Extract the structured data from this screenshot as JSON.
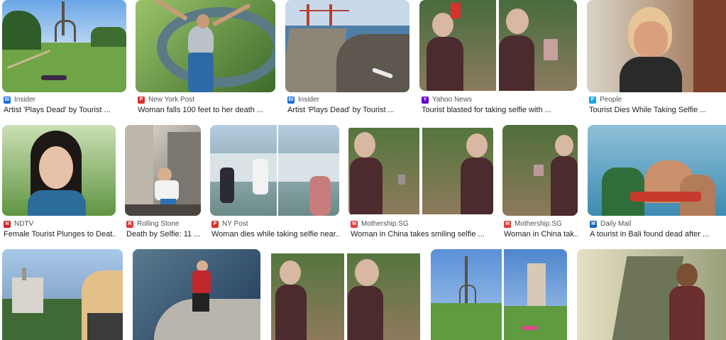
{
  "results": [
    {
      "source": "Insider",
      "caption": "Artist 'Plays Dead' by Tourist ...",
      "fav_color": "#1a6de0",
      "fav_glyph": "BI",
      "icon": "insider-favicon-icon"
    },
    {
      "source": "New York Post",
      "caption": "Woman falls 100 feet to her death ...",
      "fav_color": "#d93025",
      "fav_glyph": "P",
      "icon": "nypost-favicon-icon"
    },
    {
      "source": "Insider",
      "caption": "Artist 'Plays Dead' by Tourist ...",
      "fav_color": "#1a6de0",
      "fav_glyph": "BI",
      "icon": "insider-favicon-icon"
    },
    {
      "source": "Yahoo News",
      "caption": "Tourist blasted for taking selfie with ...",
      "fav_color": "#6001d2",
      "fav_glyph": "Y",
      "icon": "yahoo-favicon-icon"
    },
    {
      "source": "People",
      "caption": "Tourist Dies While Taking Selfie ...",
      "fav_color": "#1ba1e2",
      "fav_glyph": "P",
      "icon": "people-favicon-icon"
    },
    {
      "source": "NDTV",
      "caption": "Female Tourist Plunges to Deat...",
      "fav_color": "#c62828",
      "fav_glyph": "N",
      "icon": "ndtv-favicon-icon"
    },
    {
      "source": "Rolling Stone",
      "caption": "Death by Selfie: 11 ...",
      "fav_color": "#e53935",
      "fav_glyph": "R",
      "icon": "rollingstone-favicon-icon"
    },
    {
      "source": "NY Post",
      "caption": "Woman dies while taking selfie near...",
      "fav_color": "#d93025",
      "fav_glyph": "P",
      "icon": "nypost-favicon-icon"
    },
    {
      "source": "Mothership.SG",
      "caption": "Woman in China takes smiling selfie ...",
      "fav_color": "#e53935",
      "fav_glyph": "M",
      "icon": "mothership-favicon-icon"
    },
    {
      "source": "Mothership.SG",
      "caption": "Woman in China tak...",
      "fav_color": "#e53935",
      "fav_glyph": "M",
      "icon": "mothership-favicon-icon"
    },
    {
      "source": "Daily Mail",
      "caption": "A tourist in Bali found dead after ...",
      "fav_color": "#1565c0",
      "fav_glyph": "M",
      "icon": "dailymail-favicon-icon"
    },
    {
      "source": "",
      "caption": "",
      "fav_color": "",
      "fav_glyph": "",
      "icon": ""
    },
    {
      "source": "",
      "caption": "",
      "fav_color": "",
      "fav_glyph": "",
      "icon": ""
    },
    {
      "source": "",
      "caption": "",
      "fav_color": "",
      "fav_glyph": "",
      "icon": ""
    },
    {
      "source": "",
      "caption": "",
      "fav_color": "",
      "fav_glyph": "",
      "icon": ""
    },
    {
      "source": "",
      "caption": "",
      "fav_color": "",
      "fav_glyph": "",
      "icon": ""
    }
  ]
}
